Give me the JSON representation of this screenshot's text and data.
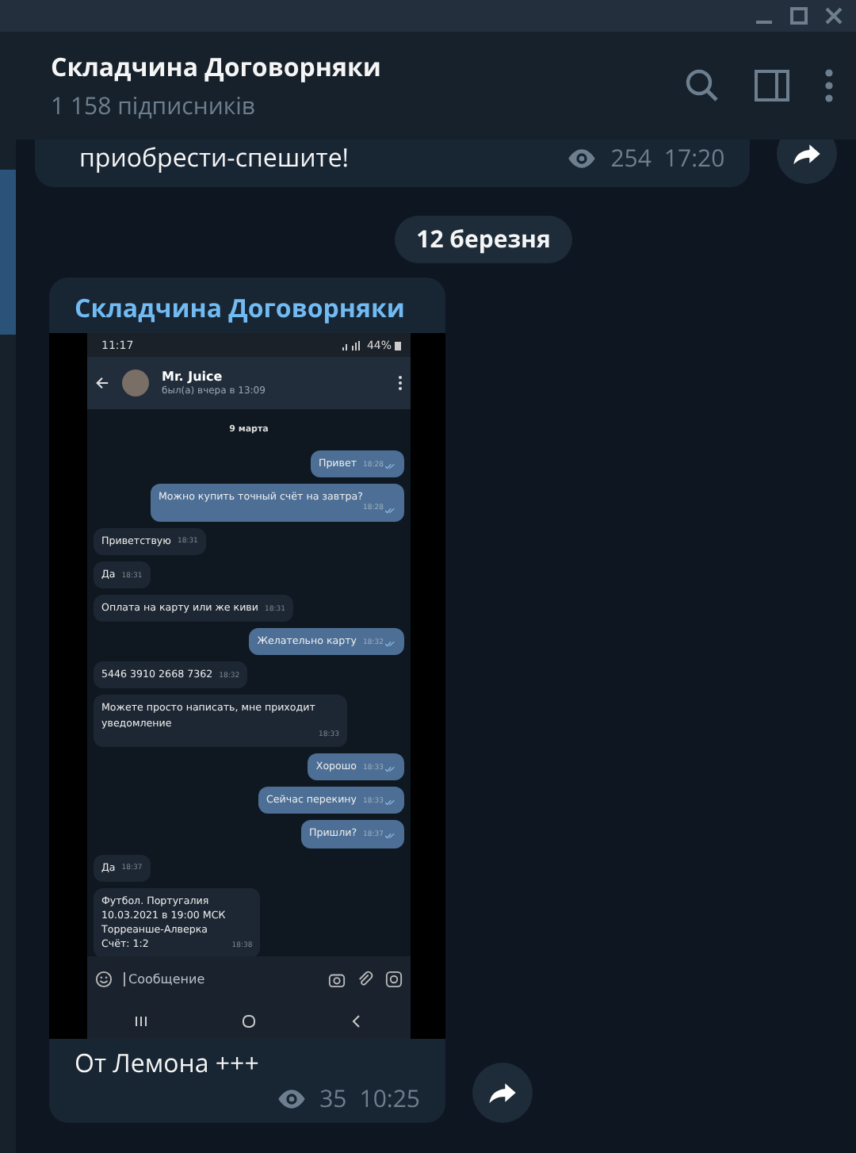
{
  "header": {
    "title": "Складчина Договорняки",
    "subtitle": "1 158 підписників"
  },
  "messages": [
    {
      "kind": "post_tail",
      "text": "приобрести-спешите!",
      "views": "254",
      "time": "17:20"
    },
    {
      "kind": "date",
      "text": "12 березня"
    },
    {
      "kind": "photo_post",
      "author": "Складчина Договорняки",
      "text": "От Лемона +++",
      "views": "35",
      "time": "10:25",
      "screenshot": {
        "status_time": "11:17",
        "battery": "44%",
        "contact": "Mr. Juice",
        "last_seen": "был(а) вчера в 13:09",
        "date": "9 марта",
        "placeholder": "Сообщение",
        "messages": [
          {
            "kind": "out",
            "text": "Привет",
            "time": "18:28"
          },
          {
            "kind": "out",
            "text": "Можно купить точный счёт на завтра?",
            "time": "18:28"
          },
          {
            "kind": "in",
            "text": "Приветствую",
            "time": "18:31"
          },
          {
            "kind": "in",
            "text": "Да",
            "time": "18:31"
          },
          {
            "kind": "in",
            "text": "Оплата на карту или же киви",
            "time": "18:31"
          },
          {
            "kind": "out",
            "text": "Желательно карту",
            "time": "18:32"
          },
          {
            "kind": "in",
            "text": "5446 3910 2668 7362",
            "time": "18:32"
          },
          {
            "kind": "in",
            "text": "Можете просто написать, мне приходит уведомление",
            "time": "18:33"
          },
          {
            "kind": "out",
            "text": "Хорошо",
            "time": "18:33"
          },
          {
            "kind": "out",
            "text": "Сейчас перекину",
            "time": "18:33"
          },
          {
            "kind": "out",
            "text": "Пришли?",
            "time": "18:37"
          },
          {
            "kind": "in",
            "text": "Да",
            "time": "18:37"
          },
          {
            "kind": "in",
            "text": "Футбол. Португалия\n10.03.2021 в 19:00 МСК\nТорреанше-Алверка\nСчёт: 1:2",
            "time": "18:38"
          }
        ]
      }
    }
  ]
}
